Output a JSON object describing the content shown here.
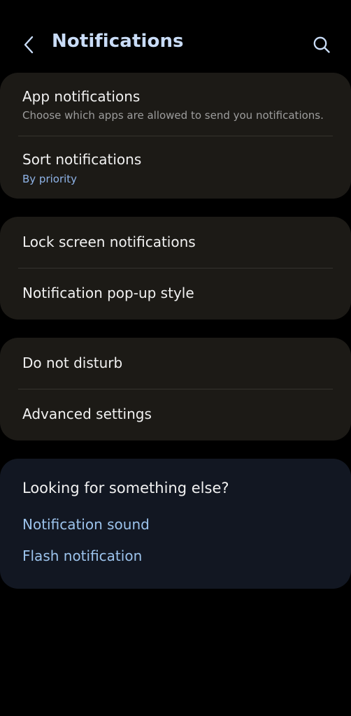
{
  "header": {
    "title": "Notifications",
    "back_icon": "chevron-left-icon",
    "search_icon": "search-icon"
  },
  "groups": [
    {
      "items": [
        {
          "title": "App notifications",
          "subtitle": "Choose which apps are allowed to send you notifications."
        },
        {
          "title": "Sort notifications",
          "subtitle": "By priority"
        }
      ]
    },
    {
      "items": [
        {
          "title": "Lock screen notifications"
        },
        {
          "title": "Notification pop-up style"
        }
      ]
    },
    {
      "items": [
        {
          "title": "Do not disturb"
        },
        {
          "title": "Advanced settings"
        }
      ]
    }
  ],
  "suggestions": {
    "title": "Looking for something else?",
    "links": [
      "Notification sound",
      "Flash notification"
    ]
  },
  "colors": {
    "background": "#000000",
    "card": "#1c1a16",
    "suggestion_card": "#121722",
    "title_accent": "#c9dcf7",
    "link": "#9cc3ec",
    "subtitle_accent": "#8fb4e8"
  }
}
